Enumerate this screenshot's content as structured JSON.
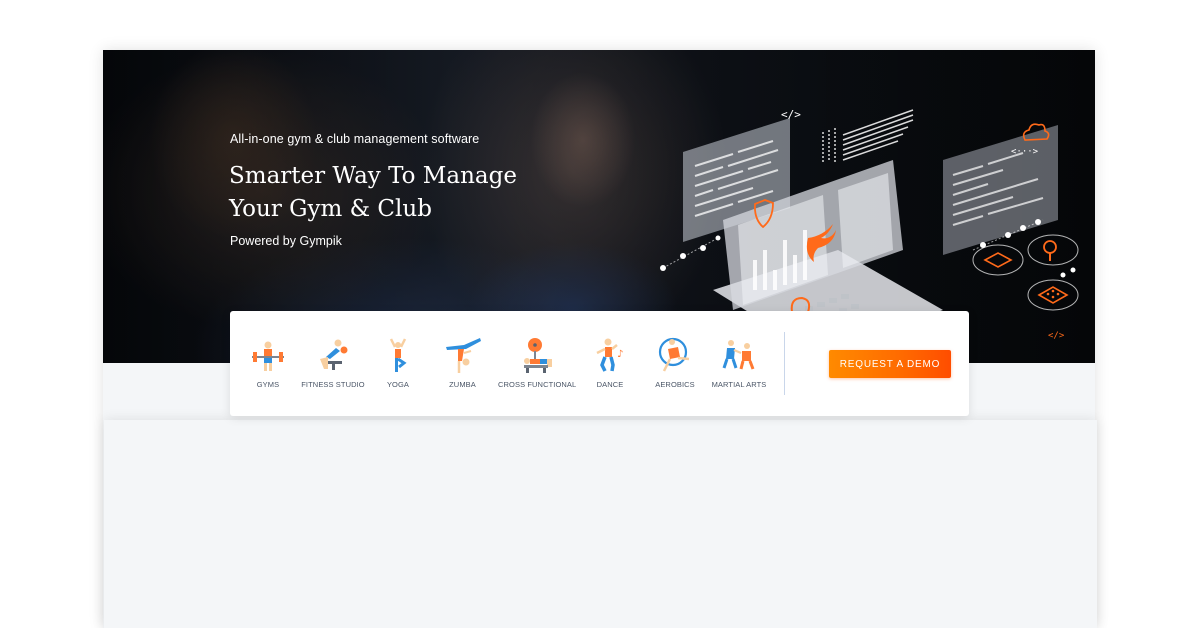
{
  "hero": {
    "kicker": "All-in-one gym & club management software",
    "title_line_1": "Smarter Way To Manage",
    "title_line_2": "Your Gym & Club",
    "powered_by": "Powered by Gympik"
  },
  "illustration": {
    "description": "isometric laptop with floating code panels",
    "code_tag_label": "</>",
    "arrows_label": "<···>",
    "icons": [
      "shield-icon",
      "cloud-icon",
      "map-pin-icon",
      "mail-icon",
      "search-icon",
      "grid-icon",
      "logo-icon"
    ]
  },
  "categories": [
    {
      "label": "GYMS",
      "icon": "weightlifter-icon"
    },
    {
      "label": "FITNESS STUDIO",
      "icon": "fitness-bench-icon"
    },
    {
      "label": "YOGA",
      "icon": "yoga-icon"
    },
    {
      "label": "ZUMBA",
      "icon": "zumba-icon"
    },
    {
      "label": "CROSS FUNCTIONAL",
      "icon": "bench-press-icon"
    },
    {
      "label": "DANCE",
      "icon": "dancer-icon"
    },
    {
      "label": "AEROBICS",
      "icon": "hoop-icon"
    },
    {
      "label": "MARTIAL ARTS",
      "icon": "martial-arts-icon"
    }
  ],
  "cta": {
    "label": "REQUEST A DEMO"
  },
  "colors": {
    "accent_orange": "#ff6a00",
    "icon_blue": "#2f8fdd",
    "icon_orange": "#ff7a33",
    "skin": "#f8cfa0",
    "page_bg": "#f4f6f8",
    "hero_bg": "#0a0d12"
  }
}
